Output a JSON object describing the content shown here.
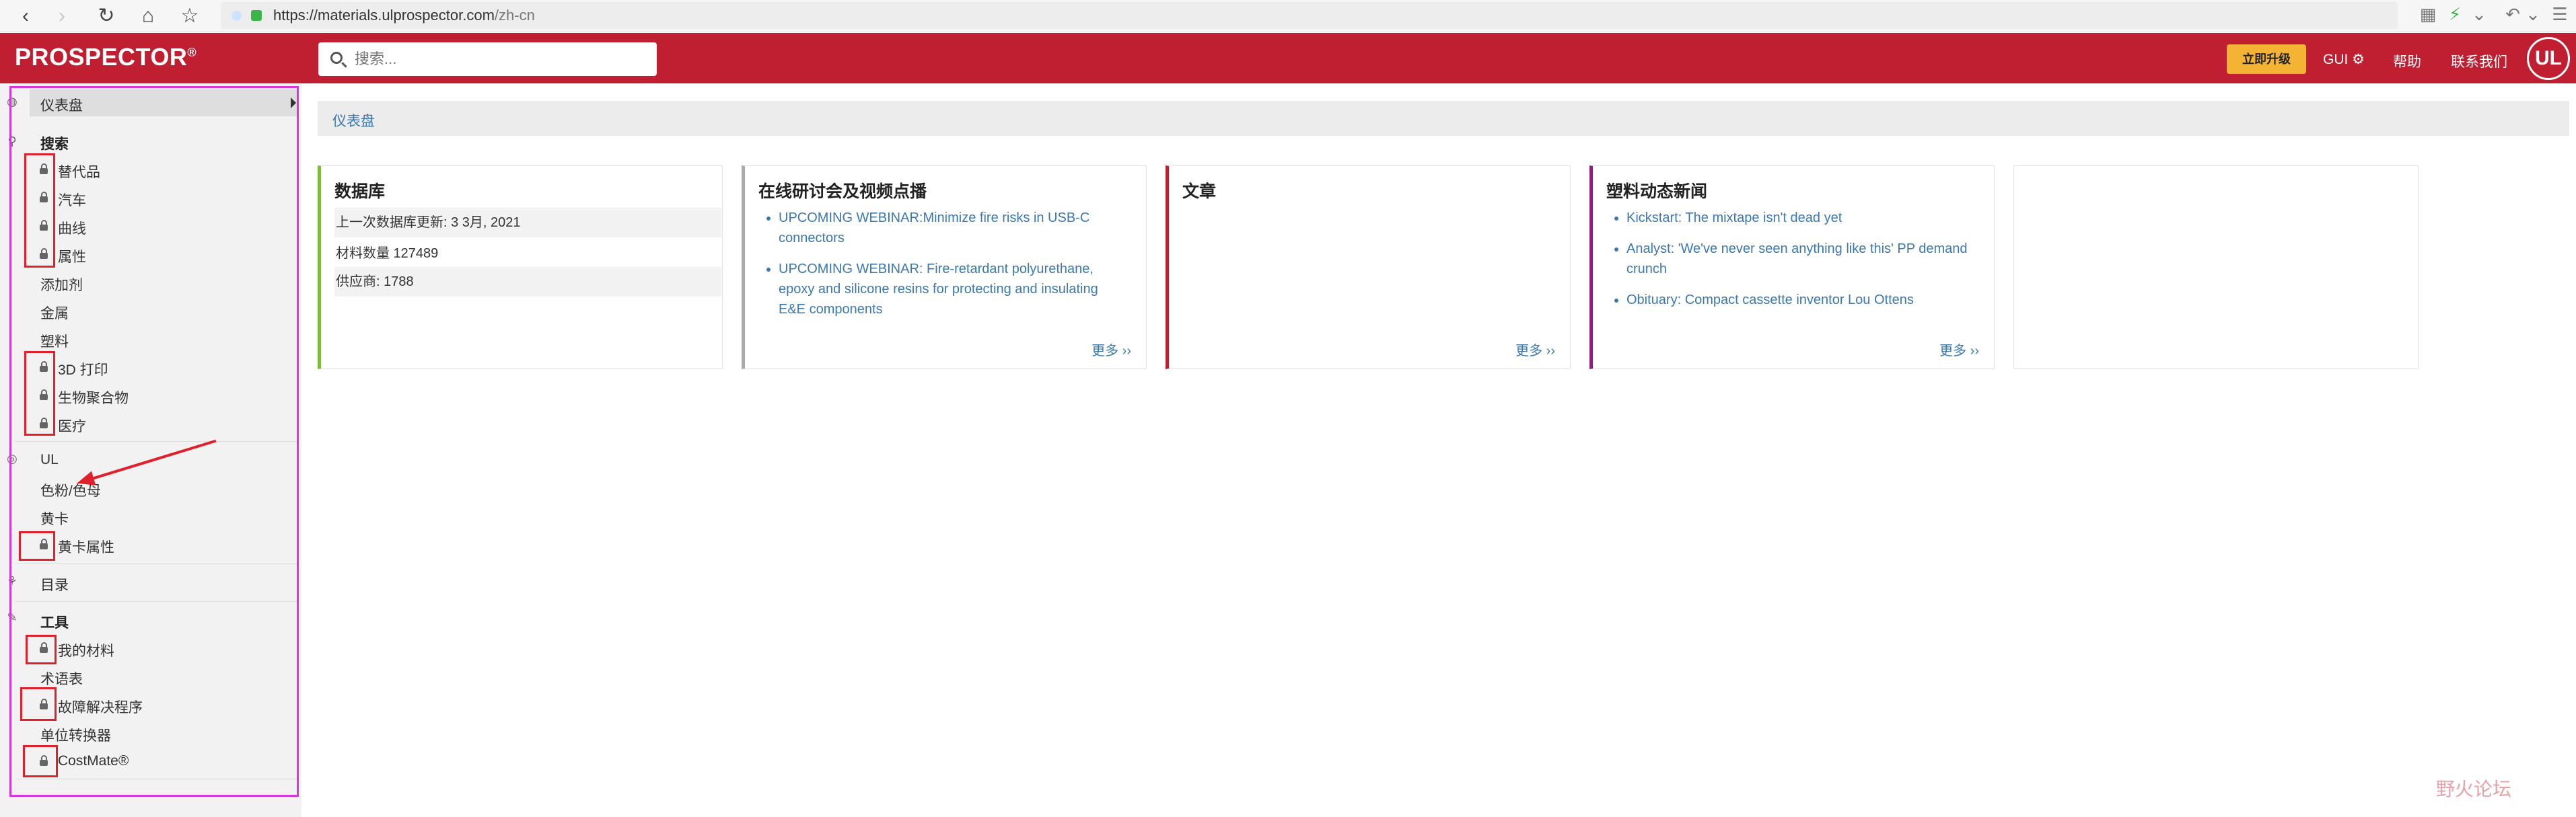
{
  "browser": {
    "url_host": "https://materials.ulprospector.com",
    "url_path": "/zh-cn",
    "back_glyph": "‹",
    "forward_glyph": "›",
    "reload_glyph": "↻",
    "home_glyph": "⌂",
    "star_glyph": "☆",
    "toolbar_glyphs": [
      "▦",
      "⚡",
      "⌄",
      "↶",
      "⌄",
      "☰"
    ]
  },
  "header": {
    "logo": "PROSPECTOR",
    "logo_mark": "®",
    "search_placeholder": "搜索...",
    "upgrade_label": "立即升级",
    "gui_label": "GUI ⚙",
    "help_label": "帮助",
    "contact_label": "联系我们",
    "ul_badge": "UL",
    "brand_color": "#c01f32",
    "upgrade_color": "#f5b335"
  },
  "sidebar": {
    "dashboard": "仪表盘",
    "search_heading": "搜索",
    "search_items": [
      "替代品",
      "汽车",
      "曲线",
      "属性",
      "添加剂",
      "金属",
      "塑料",
      "3D 打印",
      "生物聚合物",
      "医疗"
    ],
    "ul_heading": "UL",
    "ul_items": [
      "色粉/色母",
      "黄卡",
      "黄卡属性"
    ],
    "catalog": "目录",
    "tools_heading": "工具",
    "tools_items": [
      "我的材料",
      "术语表",
      "故障解决程序",
      "单位转换器",
      "CostMate®"
    ],
    "icons": {
      "dashboard": "dashboard-icon",
      "search": "search-icon",
      "ul": "ul-icon",
      "catalog": "catalog-icon",
      "tools": "wrench-icon",
      "locked": "lock-icon"
    }
  },
  "breadcrumb": "仪表盘",
  "cards": {
    "database": {
      "title": "数据库",
      "rows": [
        "上一次数据库更新:   3 3月, 2021",
        "材料数量 127489",
        "供应商:   1788"
      ],
      "accent": "#7dbb3c"
    },
    "webinars": {
      "title": "在线研讨会及视频点播",
      "items": [
        "UPCOMING WEBINAR:Minimize fire risks in USB-C connectors",
        "UPCOMING WEBINAR: Fire-retardant polyurethane, epoxy and silicone resins for protecting and insulating E&E components"
      ],
      "more": "更多 ››",
      "accent": "#aaaaaa"
    },
    "articles": {
      "title": "文章",
      "more": "更多 ››",
      "accent": "#c01f32"
    },
    "news": {
      "title": "塑料动态新闻",
      "items": [
        "Kickstart: The mixtape isn't dead yet",
        "Analyst: 'We've never seen anything like this' PP demand crunch",
        "Obituary: Compact cassette inventor Lou Ottens"
      ],
      "more": "更多 ››",
      "accent": "#8e1f7a"
    }
  },
  "watermark": "野火论坛",
  "annotation_colors": {
    "box": "#e0202a",
    "frame": "#d936d9"
  }
}
